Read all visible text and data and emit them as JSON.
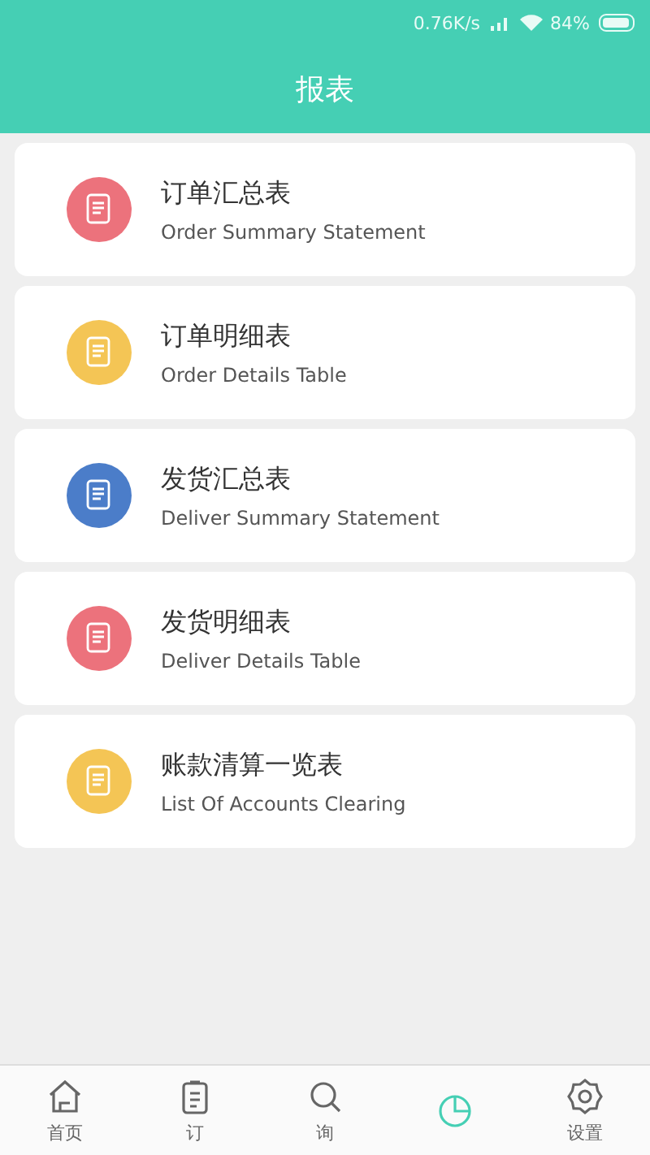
{
  "status_bar": {
    "speed": "0.76K/s",
    "battery": "84%"
  },
  "header": {
    "title": "报表"
  },
  "reports": [
    {
      "title": "订单汇总表",
      "subtitle": "Order Summary Statement",
      "color": "#ec727c"
    },
    {
      "title": "订单明细表",
      "subtitle": "Order Details Table",
      "color": "#f4c555"
    },
    {
      "title": "发货汇总表",
      "subtitle": "Deliver Summary Statement",
      "color": "#4b7dc9"
    },
    {
      "title": "发货明细表",
      "subtitle": "Deliver Details Table",
      "color": "#ec727c"
    },
    {
      "title": "账款清算一览表",
      "subtitle": "List Of Accounts Clearing",
      "color": "#f4c555"
    }
  ],
  "tab_bar": [
    {
      "kind": "home",
      "label": "首页",
      "selected": false
    },
    {
      "kind": "clipboard",
      "label": "订",
      "selected": false
    },
    {
      "kind": "search",
      "label": "询",
      "selected": false
    },
    {
      "kind": "chart",
      "selected": true
    },
    {
      "kind": "settings",
      "label": "设置",
      "selected": false
    }
  ]
}
